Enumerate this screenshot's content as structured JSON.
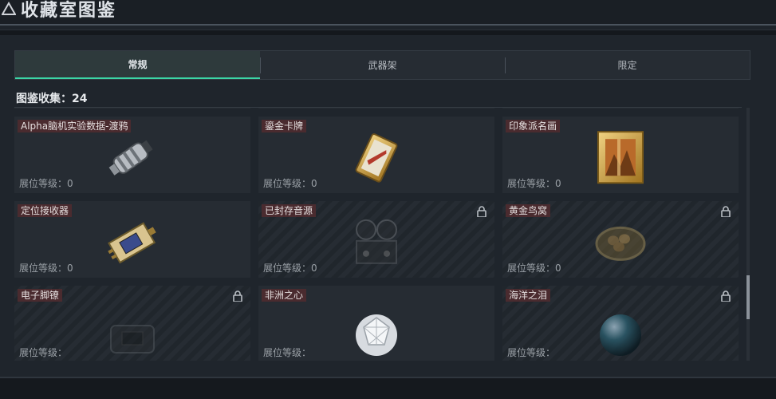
{
  "header": {
    "title": "收藏室图鉴"
  },
  "tabs": [
    {
      "label": "常规",
      "active": true
    },
    {
      "label": "武器架",
      "active": false
    },
    {
      "label": "限定",
      "active": false
    }
  ],
  "collection": {
    "label": "图鉴收集：24"
  },
  "level_label": "展位等级：",
  "items": [
    {
      "name": "",
      "level": "0",
      "locked": false,
      "icon": "pipe-item-icon"
    },
    {
      "name": "",
      "level": "0",
      "locked": false,
      "icon": "chain-item-icon"
    },
    {
      "name": "",
      "level": "0",
      "locked": false,
      "icon": "frame-item-icon"
    },
    {
      "name": "Alpha脑机实验数据-渡鸦",
      "level": "0",
      "locked": false,
      "icon": "data-canister-icon"
    },
    {
      "name": "鎏金卡牌",
      "level": "0",
      "locked": false,
      "icon": "gilded-card-icon"
    },
    {
      "name": "印象派名画",
      "level": "0",
      "locked": false,
      "icon": "painting-icon"
    },
    {
      "name": "定位接收器",
      "level": "0",
      "locked": false,
      "icon": "gps-receiver-icon"
    },
    {
      "name": "已封存音源",
      "level": "0",
      "locked": true,
      "icon": "reel-recorder-icon"
    },
    {
      "name": "黄金鸟窝",
      "level": "0",
      "locked": true,
      "icon": "golden-nest-icon"
    },
    {
      "name": "电子脚镣",
      "level": "",
      "locked": true,
      "icon": "ankle-monitor-icon"
    },
    {
      "name": "非洲之心",
      "level": "",
      "locked": false,
      "icon": "diamond-icon"
    },
    {
      "name": "海洋之泪",
      "level": "",
      "locked": true,
      "icon": "ocean-pearl-icon"
    }
  ],
  "colors": {
    "accent": "#3bd6a6",
    "name_tag_bg": "#4a2b2f",
    "panel_bg": "#1f252c"
  }
}
